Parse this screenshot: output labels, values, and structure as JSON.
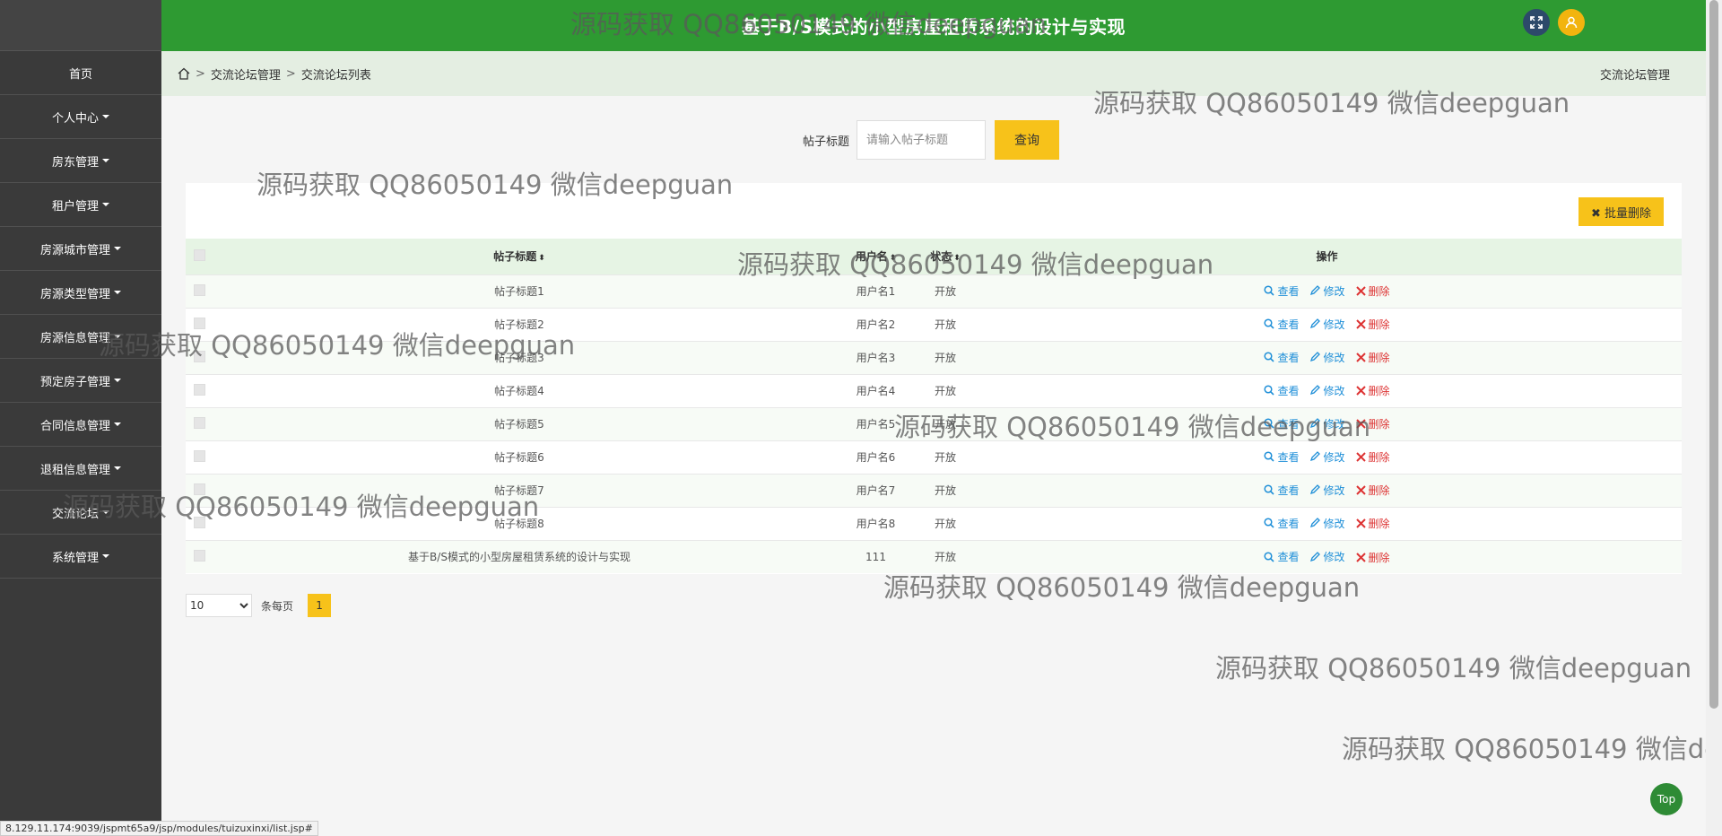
{
  "header": {
    "title": "基于B/S模式的小型房屋租赁系统的设计与实现"
  },
  "sidebar": {
    "items": [
      {
        "label": "首页",
        "dropdown": false
      },
      {
        "label": "个人中心",
        "dropdown": true
      },
      {
        "label": "房东管理",
        "dropdown": true
      },
      {
        "label": "租户管理",
        "dropdown": true
      },
      {
        "label": "房源城市管理",
        "dropdown": true
      },
      {
        "label": "房源类型管理",
        "dropdown": true
      },
      {
        "label": "房源信息管理",
        "dropdown": true
      },
      {
        "label": "预定房子管理",
        "dropdown": true
      },
      {
        "label": "合同信息管理",
        "dropdown": true
      },
      {
        "label": "退租信息管理",
        "dropdown": true
      },
      {
        "label": "交流论坛",
        "dropdown": true
      },
      {
        "label": "系统管理",
        "dropdown": true
      }
    ]
  },
  "breadcrumb": {
    "level1": "交流论坛管理",
    "level2": "交流论坛列表",
    "right": "交流论坛管理"
  },
  "search": {
    "label": "帖子标题",
    "placeholder": "请输入帖子标题",
    "button": "查询"
  },
  "toolbar": {
    "batch_delete": "批量删除"
  },
  "table": {
    "columns": [
      "帖子标题",
      "用户名",
      "状态",
      "操作"
    ],
    "rows": [
      {
        "title": "帖子标题1",
        "user": "用户名1",
        "status": "开放"
      },
      {
        "title": "帖子标题2",
        "user": "用户名2",
        "status": "开放"
      },
      {
        "title": "帖子标题3",
        "user": "用户名3",
        "status": "开放"
      },
      {
        "title": "帖子标题4",
        "user": "用户名4",
        "status": "开放"
      },
      {
        "title": "帖子标题5",
        "user": "用户名5",
        "status": "开放"
      },
      {
        "title": "帖子标题6",
        "user": "用户名6",
        "status": "开放"
      },
      {
        "title": "帖子标题7",
        "user": "用户名7",
        "status": "开放"
      },
      {
        "title": "帖子标题8",
        "user": "用户名8",
        "status": "开放"
      },
      {
        "title": "基于B/S模式的小型房屋租赁系统的设计与实现",
        "user": "111",
        "status": "开放"
      }
    ],
    "actions": {
      "view": "查看",
      "edit": "修改",
      "delete": "删除"
    }
  },
  "pagination": {
    "page_size": "10",
    "per_page_label": "条每页",
    "current_page": "1"
  },
  "top_button": "Top",
  "status_url": "8.129.11.174:9039/jspmt65a9/jsp/modules/tuizuxinxi/list.jsp#",
  "watermark": {
    "text": "源码获取 QQ86050149 微信deepguan"
  },
  "colors": {
    "header": "#2e9a32",
    "sidebar": "#3a3a3a",
    "accent": "#f7c21a",
    "link": "#1f8fd8",
    "danger": "#d33333"
  }
}
